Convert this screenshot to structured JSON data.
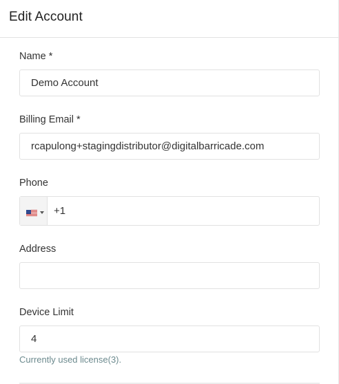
{
  "header": {
    "title": "Edit Account"
  },
  "form": {
    "name": {
      "label": "Name *",
      "value": "Demo Account"
    },
    "billing_email": {
      "label": "Billing Email *",
      "value": "rcapulong+stagingdistributor@digitalbarricade.com"
    },
    "phone": {
      "label": "Phone",
      "country": "us-flag-icon",
      "value": "+1"
    },
    "address": {
      "label": "Address",
      "value": ""
    },
    "device_limit": {
      "label": "Device Limit",
      "value": "4",
      "help": "Currently used license(3)."
    }
  }
}
